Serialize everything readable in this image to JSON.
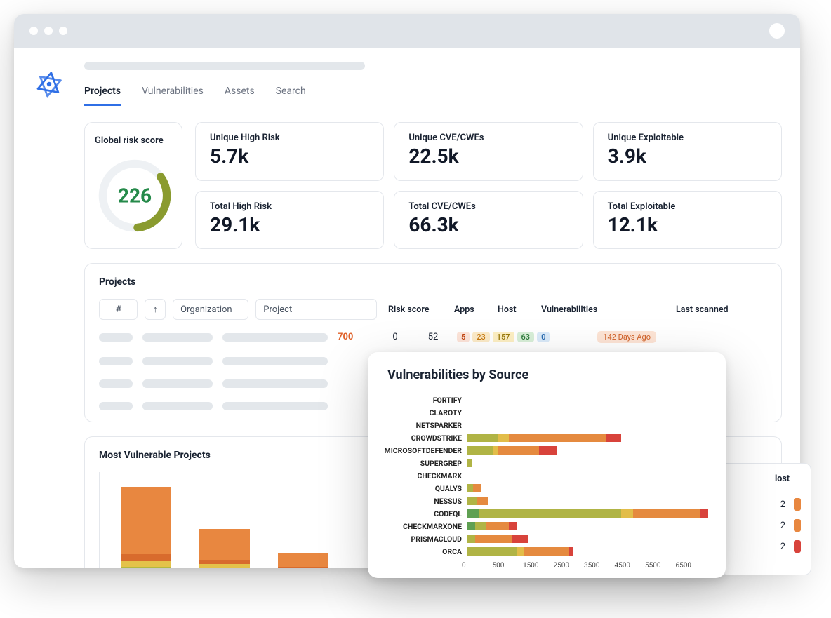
{
  "tabs": [
    "Projects",
    "Vulnerabilities",
    "Assets",
    "Search"
  ],
  "active_tab": 0,
  "global_risk": {
    "title": "Global risk score",
    "value": "226"
  },
  "stats": [
    {
      "label": "Unique High Risk",
      "value": "5.7k"
    },
    {
      "label": "Unique CVE/CWEs",
      "value": "22.5k"
    },
    {
      "label": "Unique Exploitable",
      "value": "3.9k"
    },
    {
      "label": "Total High Risk",
      "value": "29.1k"
    },
    {
      "label": "Total CVE/CWEs",
      "value": "66.3k"
    },
    {
      "label": "Total Exploitable",
      "value": "12.1k"
    }
  ],
  "projects_section": {
    "title": "Projects",
    "filters": {
      "num": "#",
      "sort_icon": "↑",
      "org": "Organization",
      "proj": "Project"
    },
    "columns": {
      "risk": "Risk score",
      "apps": "Apps",
      "host": "Host",
      "vuln": "Vulnerabilities",
      "last": "Last scanned"
    },
    "row": {
      "risk": "700",
      "apps": "0",
      "host": "52",
      "badges": [
        "5",
        "23",
        "157",
        "63",
        "0"
      ],
      "last": "142 Days Ago"
    }
  },
  "most_vulnerable": {
    "title": "Most Vulnerable Projects"
  },
  "right_partial": {
    "header": "lost",
    "rows": [
      "2",
      "2",
      "2"
    ]
  },
  "vbs": {
    "title": "Vulnerabilities by Source",
    "xmax": 6500,
    "ticks": [
      "0",
      "500",
      "1500",
      "2500",
      "3500",
      "4500",
      "5500",
      "6500"
    ]
  },
  "chart_data": [
    {
      "type": "bar",
      "title": "Most Vulnerable Projects",
      "orientation": "vertical",
      "ylim": [
        0,
        140
      ],
      "series_stacked": true,
      "bars": [
        {
          "segments": [
            {
              "color": "green",
              "v": 6
            },
            {
              "color": "olive",
              "v": 8
            },
            {
              "color": "yellow",
              "v": 8
            },
            {
              "color": "dorange",
              "v": 10
            },
            {
              "color": "orange",
              "v": 96
            }
          ]
        },
        {
          "segments": [
            {
              "color": "green",
              "v": 4
            },
            {
              "color": "olive",
              "v": 6
            },
            {
              "color": "yellow",
              "v": 8
            },
            {
              "color": "dorange",
              "v": 6
            },
            {
              "color": "orange",
              "v": 44
            }
          ]
        },
        {
          "segments": [
            {
              "color": "green",
              "v": 2
            },
            {
              "color": "olive",
              "v": 4
            },
            {
              "color": "yellow",
              "v": 4
            },
            {
              "color": "dorange",
              "v": 3
            },
            {
              "color": "orange",
              "v": 20
            }
          ]
        }
      ]
    },
    {
      "type": "bar",
      "title": "Vulnerabilities by Source",
      "orientation": "horizontal",
      "xlim": [
        0,
        6500
      ],
      "categories": [
        "FORTIFY",
        "CLAROTY",
        "NETSPARKER",
        "CROWDSTRIKE",
        "MICROSOFTDEFENDER",
        "SUPERGREP",
        "CHECKMARX",
        "QUALYS",
        "NESSUS",
        "CODEQL",
        "CHECKMARXONE",
        "PRISMACLOUD",
        "ORCA"
      ],
      "series_stacked": true,
      "rows": [
        {
          "name": "FORTIFY",
          "segments": []
        },
        {
          "name": "CLAROTY",
          "segments": []
        },
        {
          "name": "NETSPARKER",
          "segments": []
        },
        {
          "name": "CROWDSTRIKE",
          "segments": [
            {
              "color": "olive",
              "v": 800
            },
            {
              "color": "yellow",
              "v": 300
            },
            {
              "color": "orange",
              "v": 2600
            },
            {
              "color": "red",
              "v": 400
            }
          ]
        },
        {
          "name": "MICROSOFTDEFENDER",
          "segments": [
            {
              "color": "olive",
              "v": 700
            },
            {
              "color": "yellow",
              "v": 100
            },
            {
              "color": "orange",
              "v": 1100
            },
            {
              "color": "red",
              "v": 500
            }
          ]
        },
        {
          "name": "SUPERGREP",
          "segments": [
            {
              "color": "olive",
              "v": 120
            }
          ]
        },
        {
          "name": "CHECKMARX",
          "segments": []
        },
        {
          "name": "QUALYS",
          "segments": [
            {
              "color": "olive",
              "v": 150
            },
            {
              "color": "orange",
              "v": 200
            }
          ]
        },
        {
          "name": "NESSUS",
          "segments": [
            {
              "color": "olive",
              "v": 250
            },
            {
              "color": "orange",
              "v": 300
            }
          ]
        },
        {
          "name": "CODEQL",
          "segments": [
            {
              "color": "green",
              "v": 300
            },
            {
              "color": "olive",
              "v": 3800
            },
            {
              "color": "yellow",
              "v": 300
            },
            {
              "color": "orange",
              "v": 1800
            },
            {
              "color": "red",
              "v": 200
            }
          ]
        },
        {
          "name": "CHECKMARXONE",
          "segments": [
            {
              "color": "green",
              "v": 200
            },
            {
              "color": "olive",
              "v": 300
            },
            {
              "color": "orange",
              "v": 600
            },
            {
              "color": "red",
              "v": 200
            }
          ]
        },
        {
          "name": "PRISMACLOUD",
          "segments": [
            {
              "color": "olive",
              "v": 200
            },
            {
              "color": "orange",
              "v": 1000
            },
            {
              "color": "red",
              "v": 400
            }
          ]
        },
        {
          "name": "ORCA",
          "segments": [
            {
              "color": "olive",
              "v": 1300
            },
            {
              "color": "yellow",
              "v": 200
            },
            {
              "color": "orange",
              "v": 1200
            },
            {
              "color": "red",
              "v": 100
            }
          ]
        }
      ]
    }
  ]
}
